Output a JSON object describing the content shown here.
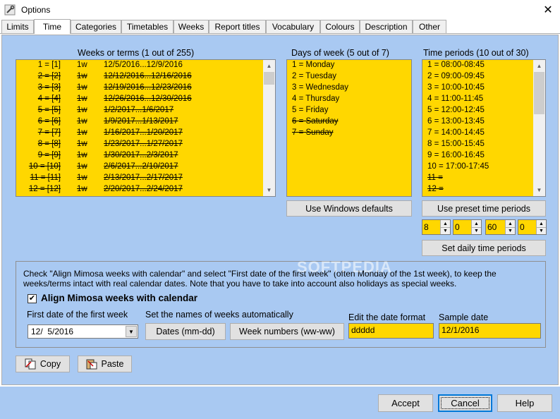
{
  "window": {
    "title": "Options",
    "close_glyph": "✕"
  },
  "tabs": [
    "Limits",
    "Time",
    "Categories",
    "Timetables",
    "Weeks",
    "Report titles",
    "Vocabulary",
    "Colours",
    "Description",
    "Other"
  ],
  "weeks": {
    "header": "Weeks or terms (1 out of 255)",
    "rows": [
      {
        "num": "1 = [1]",
        "len": "1w",
        "dates": "12/5/2016...12/9/2016",
        "disabled": false
      },
      {
        "num": "2 = [2]",
        "len": "1w",
        "dates": "12/12/2016...12/16/2016",
        "disabled": true
      },
      {
        "num": "3 = [3]",
        "len": "1w",
        "dates": "12/19/2016...12/23/2016",
        "disabled": true
      },
      {
        "num": "4 = [4]",
        "len": "1w",
        "dates": "12/26/2016...12/30/2016",
        "disabled": true
      },
      {
        "num": "5 = [5]",
        "len": "1w",
        "dates": "1/2/2017...1/6/2017",
        "disabled": true
      },
      {
        "num": "6 = [6]",
        "len": "1w",
        "dates": "1/9/2017...1/13/2017",
        "disabled": true
      },
      {
        "num": "7 = [7]",
        "len": "1w",
        "dates": "1/16/2017...1/20/2017",
        "disabled": true
      },
      {
        "num": "8 = [8]",
        "len": "1w",
        "dates": "1/23/2017...1/27/2017",
        "disabled": true
      },
      {
        "num": "9 = [9]",
        "len": "1w",
        "dates": "1/30/2017...2/3/2017",
        "disabled": true
      },
      {
        "num": "10 = [10]",
        "len": "1w",
        "dates": "2/6/2017...2/10/2017",
        "disabled": true
      },
      {
        "num": "11 = [11]",
        "len": "1w",
        "dates": "2/13/2017...2/17/2017",
        "disabled": true
      },
      {
        "num": "12 = [12]",
        "len": "1w",
        "dates": "2/20/2017...2/24/2017",
        "disabled": true
      }
    ]
  },
  "days": {
    "header": "Days of week (5 out of 7)",
    "rows": [
      {
        "text": "1 = Monday",
        "disabled": false
      },
      {
        "text": "2 = Tuesday",
        "disabled": false
      },
      {
        "text": "3 = Wednesday",
        "disabled": false
      },
      {
        "text": "4 = Thursday",
        "disabled": false
      },
      {
        "text": "5 = Friday",
        "disabled": false
      },
      {
        "text": "6 = Saturday",
        "disabled": true
      },
      {
        "text": "7 = Sunday",
        "disabled": true
      }
    ],
    "button": "Use Windows defaults"
  },
  "periods": {
    "header": "Time periods (10 out of 30)",
    "rows": [
      {
        "text": "1 = 08:00-08:45",
        "disabled": false
      },
      {
        "text": "2 = 09:00-09:45",
        "disabled": false
      },
      {
        "text": "3 = 10:00-10:45",
        "disabled": false
      },
      {
        "text": "4 = 11:00-11:45",
        "disabled": false
      },
      {
        "text": "5 = 12:00-12:45",
        "disabled": false
      },
      {
        "text": "6 = 13:00-13:45",
        "disabled": false
      },
      {
        "text": "7 = 14:00-14:45",
        "disabled": false
      },
      {
        "text": "8 = 15:00-15:45",
        "disabled": false
      },
      {
        "text": "9 = 16:00-16:45",
        "disabled": false
      },
      {
        "text": "10 = 17:00-17:45",
        "disabled": false
      },
      {
        "text": "11 =",
        "disabled": true
      },
      {
        "text": "12 =",
        "disabled": true
      }
    ],
    "preset_button": "Use preset time periods",
    "spinners": [
      "8",
      "0",
      "60",
      "0"
    ],
    "daily_button": "Set daily time periods"
  },
  "calendar": {
    "instructions": "Check \"Align Mimosa weeks with calendar\" and select  \"First date of the first week\" (often Monday of the 1st week), to keep the weeks/terms intact with real calendar dates. Note that you have to take into account also holidays as special weeks.",
    "checkbox_label": "Align Mimosa weeks with calendar",
    "checked": true,
    "first_date_label": "First date of the first week",
    "first_date_value": "12/  5/2016",
    "set_names_label": "Set the names of weeks automatically",
    "dates_button": "Dates (mm-dd)",
    "weeknum_button": "Week numbers (ww-ww)",
    "format_label": "Edit the date format",
    "format_value": "ddddd",
    "sample_label": "Sample date",
    "sample_value": "12/1/2016"
  },
  "clipboard": {
    "copy": "Copy",
    "paste": "Paste"
  },
  "footer": {
    "accept": "Accept",
    "cancel": "Cancel",
    "help": "Help"
  },
  "watermark": "SOFTPEDIA"
}
